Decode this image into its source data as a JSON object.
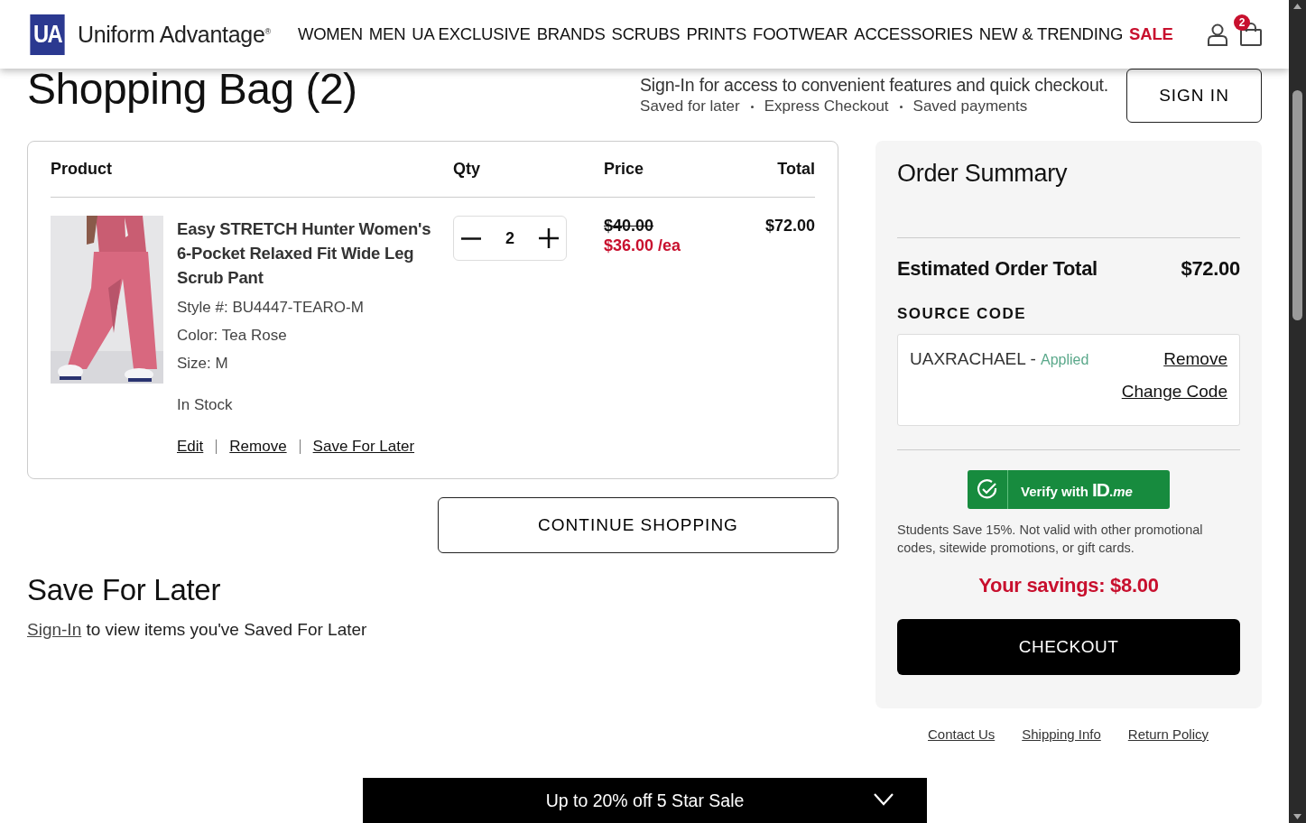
{
  "header": {
    "logo_mark": "UA",
    "brand": "Uniform Advantage$^{®}$",
    "nav": [
      {
        "label": "WOMEN",
        "kind": "normal"
      },
      {
        "label": "MEN",
        "kind": "normal"
      },
      {
        "label": "UA EXCLUSIVE",
        "kind": "normal"
      },
      {
        "label": "BRANDS",
        "kind": "normal"
      },
      {
        "label": "SCRUBS",
        "kind": "normal"
      },
      {
        "label": "PRINTS",
        "kind": "normal"
      },
      {
        "label": "FOOTWEAR",
        "kind": "normal"
      },
      {
        "label": "ACCESSORIES",
        "kind": "normal"
      },
      {
        "label": "NEW & TRENDING",
        "kind": "normal"
      },
      {
        "label": "SALE",
        "kind": "sale"
      }
    ],
    "cart_count": "2"
  },
  "page_title": "Shopping Bag (2)",
  "signin_prompt": {
    "message": "Sign-In for access to convenient features and quick checkout.",
    "benefits": [
      "Saved for later",
      "Express Checkout",
      "Saved payments"
    ],
    "button": "SIGN IN"
  },
  "cart": {
    "columns": [
      "Product",
      "Qty",
      "Price",
      "Total"
    ],
    "items": [
      {
        "name": "Easy STRETCH Hunter Women's 6-Pocket Relaxed Fit Wide Leg Scrub Pant",
        "details": [
          "Style #: BU4447-TEARO-M",
          "Color:  Tea Rose",
          "Size:  M"
        ],
        "stock": "In Stock",
        "quantity": "2",
        "original_price": "$40.00",
        "sale_price": "$36.00 /ea",
        "total": "$72.00",
        "actions": [
          "Edit",
          "Remove",
          "Save For Later"
        ]
      }
    ]
  },
  "continue_button": "CONTINUE SHOPPING",
  "save_for_later": {
    "title": "Save For Later",
    "link": "Sign-In",
    "message": "to view items you've Saved For Later"
  },
  "order_summary": {
    "title": "Order Summary",
    "total_label": "Estimated Order Total",
    "total": "$72.00",
    "source_code_label": "SOURCE CODE",
    "code": "UAXRACHAEL -",
    "code_status": "Applied",
    "code_actions": [
      "Remove",
      "Change Code"
    ],
    "verify_text": "Verify with",
    "verify_brand": "**ID**.*me*",
    "note": "Students Save 15%. Not valid with other promotional codes, sitewide promotions, or gift cards.",
    "savings": "Your savings: $8.00",
    "checkout": "CHECKOUT"
  },
  "footer_links": [
    "Contact Us",
    "Shipping Info",
    "Return Policy"
  ],
  "promo_bar": {
    "text": "Up to 20% off 5 Star Sale"
  }
}
